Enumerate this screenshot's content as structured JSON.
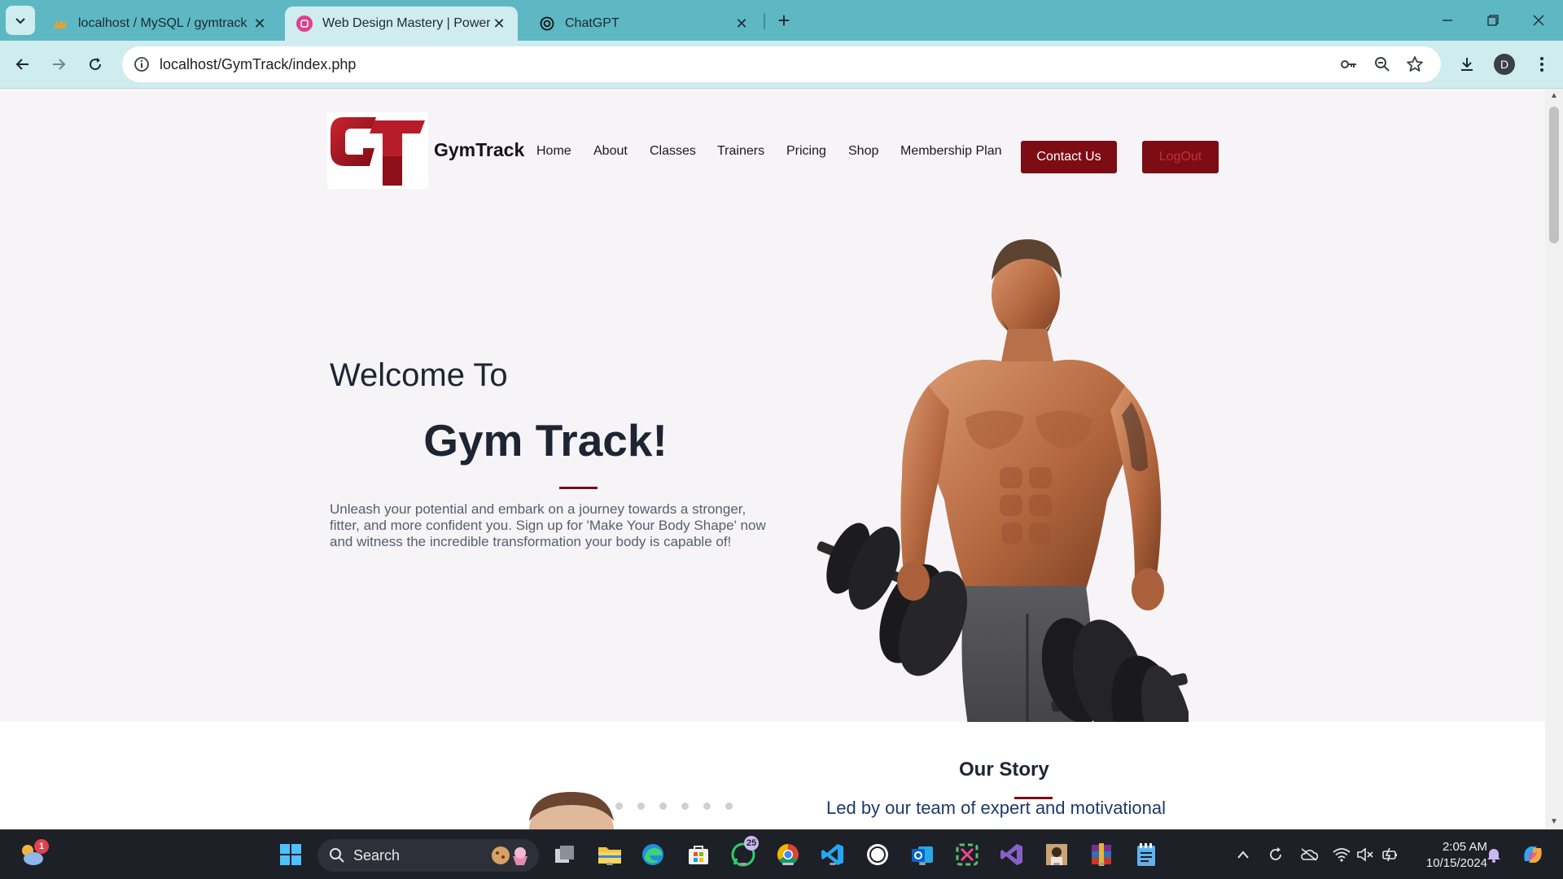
{
  "browser": {
    "tabs": [
      {
        "title": "localhost / MySQL / gymtrack /",
        "icon": "phpmyadmin-icon"
      },
      {
        "title": "Web Design Mastery | Power",
        "icon": "web-design-icon"
      },
      {
        "title": "ChatGPT",
        "icon": "chatgpt-icon"
      }
    ],
    "address": "localhost/GymTrack/index.php",
    "profile_initial": "D"
  },
  "site": {
    "brand": "GymTrack",
    "nav": [
      "Home",
      "About",
      "Classes",
      "Trainers",
      "Pricing",
      "Shop",
      "Membership Plan"
    ],
    "contact_label": "Contact Us",
    "logout_label": "LogOut",
    "accent_color": "#7d0c14"
  },
  "hero": {
    "welcome": "Welcome To",
    "title": "Gym Track!",
    "description": "Unleash your potential and embark on a journey towards a stronger, fitter, and more confident you. Sign up for 'Make Your Body Shape' now and witness the incredible transformation your body is capable of!"
  },
  "story": {
    "title": "Our Story",
    "text": "Led by our team of expert and motivational"
  },
  "taskbar": {
    "search_label": "Search",
    "weather_badge": "1",
    "whatsapp_badge": "25",
    "time": "2:05 AM",
    "date": "10/15/2024"
  }
}
